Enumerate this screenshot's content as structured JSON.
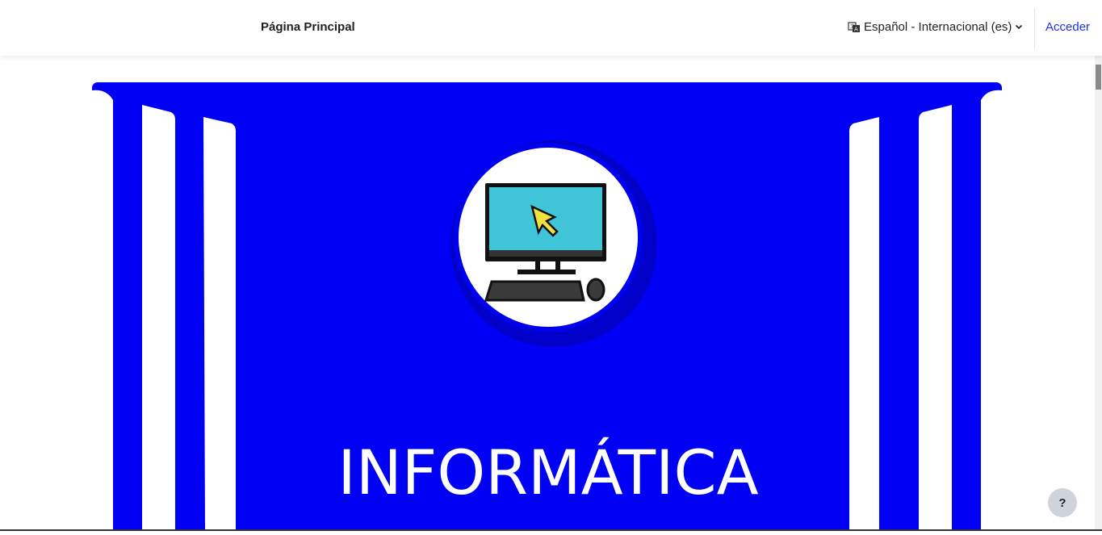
{
  "nav": {
    "home_label": "Página Principal",
    "language_label": "Español - Internacional (es)",
    "login_label": "Acceder"
  },
  "banner": {
    "title": "INFORMÁTICA",
    "background_color": "#0000f5",
    "icon": "computer-icon"
  },
  "help": {
    "label": "?"
  },
  "colors": {
    "link": "#1a33e6",
    "banner": "#0000f5",
    "screen": "#40c4d8"
  }
}
